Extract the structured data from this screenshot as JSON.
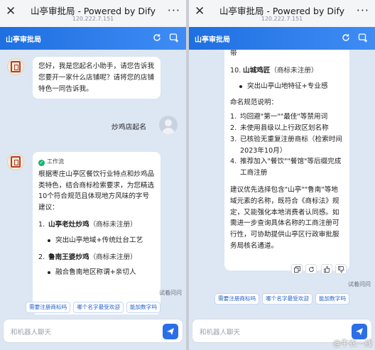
{
  "left": {
    "wx_title": "山亭审批局 - Powered by Dify",
    "wx_url": "120.222.7.151",
    "app_title": "山亭审批局",
    "greeting": "您好，我是您起名小助手，请您告诉我您要开一家什么店铺呢？请将您的店铺特色一同告诉我。",
    "user_msg": "炒鸡店起名",
    "workflow_label": "工作流",
    "answer_intro": "根据枣庄山亭区餐饮行业特点和炒鸡品类特色，结合商标检索要求，为您精选10个符合规范且体现地方风味的字号建议：",
    "items": [
      {
        "no": "1.",
        "name": "山亭老灶炒鸡",
        "note": "（商标未注册）",
        "bullet": "突出山亭地域+传统灶台工艺"
      },
      {
        "no": "2.",
        "name": "鲁南王婆炒鸡",
        "note": "（商标未注册）",
        "bullet": "融合鲁南地区称谓+亲切人"
      }
    ],
    "partial_text": "鲁南王婆炒鸡",
    "try_ask": "试着问问",
    "chips": [
      "需要注册商标吗",
      "哪个名字最受欢迎",
      "能加数字吗"
    ],
    "input_placeholder": "和机器人聊天"
  },
  "right": {
    "wx_title": "山亭审批局 - Powered by Dify",
    "wx_url": "120.222.7.151",
    "app_title": "山亭审批局",
    "top_cut": "带",
    "item10": {
      "no": "10.",
      "name": "山城鸡匠",
      "note": "（商标未注册）",
      "bullet": "突出山亭山地特征+专业感"
    },
    "rules_title": "命名规范说明：",
    "rules": [
      {
        "no": "1.",
        "text": "均回避\"第一\"\"最佳\"等禁用词"
      },
      {
        "no": "2.",
        "text": "未使用县级以上行政区划名称"
      },
      {
        "no": "3.",
        "text": "已核验无重复注册商标（检索时间2023年10月）"
      },
      {
        "no": "4.",
        "text": "推荐加入\"餐饮\"\"餐馆\"等后缀完成工商注册"
      }
    ],
    "advice": "建议优先选择包含\"山亭\"\"鲁南\"等地域元素的名称，既符合《商标法》规定，又能强化本地消费者认同感。如需进一步查询具体名称的工商注册可行性，可协助提供山亭区行政审批服务局核名通道。",
    "try_ask": "试着问问",
    "chips": [
      "需要注册商标吗",
      "哪个名字最受欢迎",
      "能加数字吗"
    ],
    "input_placeholder": "和机器人聊天",
    "watermark": "@牛衣一线"
  }
}
